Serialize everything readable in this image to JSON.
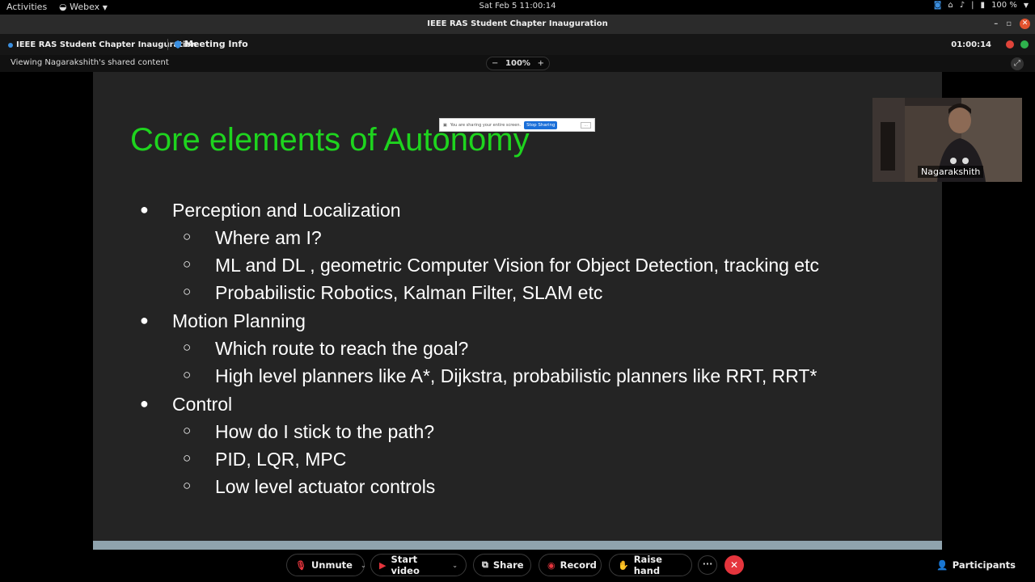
{
  "topbar": {
    "activities": "Activities",
    "app_name": "Webex",
    "clock": "Sat Feb 5  11:00:14",
    "battery": "100 %"
  },
  "window": {
    "title": "IEEE RAS Student Chapter Inauguration"
  },
  "meeting_bar": {
    "meeting_name": "IEEE RAS Student Chapter Inauguration",
    "meeting_info": "Meeting Info",
    "timer": "01:00:14"
  },
  "view_bar": {
    "viewing_text": "Viewing Nagarakshith's shared content",
    "zoom_minus": "−",
    "zoom_value": "100%",
    "zoom_plus": "+"
  },
  "share_notice": {
    "text": "You are sharing your entire screen.",
    "stop_label": "Stop Sharing",
    "more_label": "..."
  },
  "slide": {
    "title": "Core elements of Autonomy",
    "bullet_l1": "●",
    "bullet_l2": "○",
    "items": [
      {
        "level": 1,
        "text": "Perception and Localization"
      },
      {
        "level": 2,
        "text": "Where am I?"
      },
      {
        "level": 2,
        "text": "ML and DL , geometric Computer Vision for Object Detection, tracking etc"
      },
      {
        "level": 2,
        "text": "Probabilistic Robotics, Kalman Filter, SLAM etc"
      },
      {
        "level": 1,
        "text": "Motion Planning"
      },
      {
        "level": 2,
        "text": "Which route to reach the goal?"
      },
      {
        "level": 2,
        "text": "High level planners like A*, Dijkstra, probabilistic planners like RRT, RRT*"
      },
      {
        "level": 1,
        "text": "Control"
      },
      {
        "level": 2,
        "text": "How do I stick to the path?"
      },
      {
        "level": 2,
        "text": "PID, LQR, MPC"
      },
      {
        "level": 2,
        "text": "Low level actuator controls"
      }
    ]
  },
  "self_view": {
    "name": "Nagarakshith"
  },
  "controls": {
    "unmute": "Unmute",
    "start_video": "Start video",
    "share": "Share",
    "record": "Record",
    "raise_hand": "Raise hand",
    "more": "···",
    "end": "✕",
    "participants": "Participants"
  },
  "colors": {
    "slide_title": "#1ed41e",
    "slide_bg": "#242424",
    "end_call": "#e5353d"
  }
}
